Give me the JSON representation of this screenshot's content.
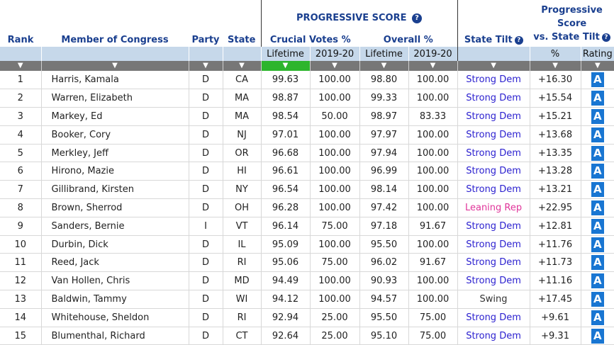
{
  "header": {
    "rank": "Rank",
    "member": "Member of Congress",
    "party": "Party",
    "state": "State",
    "progressive_score": "PROGRESSIVE SCORE",
    "crucial_votes": "Crucial Votes %",
    "overall": "Overall %",
    "state_tilt": "State Tilt",
    "vs_tilt_line1": "Progressive",
    "vs_tilt_line2": "Score",
    "vs_tilt_line3": "vs. State Tilt",
    "lifetime": "Lifetime",
    "period": "2019-20",
    "pct": "%",
    "rating": "Rating",
    "help_glyph": "?",
    "sort_arrow": "▼"
  },
  "colors": {
    "header_text": "#1a3f8f",
    "subheader_bg": "#c6d8ea",
    "sort_bar_bg": "#777777",
    "sort_active_bg": "#2db52d",
    "strong_dem": "#2a1fcf",
    "leaning_rep": "#e0359a",
    "grade_bg": "#1976d2"
  },
  "rows": [
    {
      "rank": "1",
      "name": "Harris, Kamala",
      "party": "D",
      "state": "CA",
      "cv_life": "99.63",
      "cv_1920": "100.00",
      "ov_life": "98.80",
      "ov_1920": "100.00",
      "tilt": "Strong Dem",
      "tilt_kind": "dem",
      "vs": "+16.30",
      "grade": "A"
    },
    {
      "rank": "2",
      "name": "Warren, Elizabeth",
      "party": "D",
      "state": "MA",
      "cv_life": "98.87",
      "cv_1920": "100.00",
      "ov_life": "99.33",
      "ov_1920": "100.00",
      "tilt": "Strong Dem",
      "tilt_kind": "dem",
      "vs": "+15.54",
      "grade": "A"
    },
    {
      "rank": "3",
      "name": "Markey, Ed",
      "party": "D",
      "state": "MA",
      "cv_life": "98.54",
      "cv_1920": "50.00",
      "ov_life": "98.97",
      "ov_1920": "83.33",
      "tilt": "Strong Dem",
      "tilt_kind": "dem",
      "vs": "+15.21",
      "grade": "A"
    },
    {
      "rank": "4",
      "name": "Booker, Cory",
      "party": "D",
      "state": "NJ",
      "cv_life": "97.01",
      "cv_1920": "100.00",
      "ov_life": "97.97",
      "ov_1920": "100.00",
      "tilt": "Strong Dem",
      "tilt_kind": "dem",
      "vs": "+13.68",
      "grade": "A"
    },
    {
      "rank": "5",
      "name": "Merkley, Jeff",
      "party": "D",
      "state": "OR",
      "cv_life": "96.68",
      "cv_1920": "100.00",
      "ov_life": "97.94",
      "ov_1920": "100.00",
      "tilt": "Strong Dem",
      "tilt_kind": "dem",
      "vs": "+13.35",
      "grade": "A"
    },
    {
      "rank": "6",
      "name": "Hirono, Mazie",
      "party": "D",
      "state": "HI",
      "cv_life": "96.61",
      "cv_1920": "100.00",
      "ov_life": "96.99",
      "ov_1920": "100.00",
      "tilt": "Strong Dem",
      "tilt_kind": "dem",
      "vs": "+13.28",
      "grade": "A"
    },
    {
      "rank": "7",
      "name": "Gillibrand, Kirsten",
      "party": "D",
      "state": "NY",
      "cv_life": "96.54",
      "cv_1920": "100.00",
      "ov_life": "98.14",
      "ov_1920": "100.00",
      "tilt": "Strong Dem",
      "tilt_kind": "dem",
      "vs": "+13.21",
      "grade": "A"
    },
    {
      "rank": "8",
      "name": "Brown, Sherrod",
      "party": "D",
      "state": "OH",
      "cv_life": "96.28",
      "cv_1920": "100.00",
      "ov_life": "97.42",
      "ov_1920": "100.00",
      "tilt": "Leaning Rep",
      "tilt_kind": "rep",
      "vs": "+22.95",
      "grade": "A"
    },
    {
      "rank": "9",
      "name": "Sanders, Bernie",
      "party": "I",
      "state": "VT",
      "cv_life": "96.14",
      "cv_1920": "75.00",
      "ov_life": "97.18",
      "ov_1920": "91.67",
      "tilt": "Strong Dem",
      "tilt_kind": "dem",
      "vs": "+12.81",
      "grade": "A"
    },
    {
      "rank": "10",
      "name": "Durbin, Dick",
      "party": "D",
      "state": "IL",
      "cv_life": "95.09",
      "cv_1920": "100.00",
      "ov_life": "95.50",
      "ov_1920": "100.00",
      "tilt": "Strong Dem",
      "tilt_kind": "dem",
      "vs": "+11.76",
      "grade": "A"
    },
    {
      "rank": "11",
      "name": "Reed, Jack",
      "party": "D",
      "state": "RI",
      "cv_life": "95.06",
      "cv_1920": "75.00",
      "ov_life": "96.02",
      "ov_1920": "91.67",
      "tilt": "Strong Dem",
      "tilt_kind": "dem",
      "vs": "+11.73",
      "grade": "A"
    },
    {
      "rank": "12",
      "name": "Van Hollen, Chris",
      "party": "D",
      "state": "MD",
      "cv_life": "94.49",
      "cv_1920": "100.00",
      "ov_life": "90.93",
      "ov_1920": "100.00",
      "tilt": "Strong Dem",
      "tilt_kind": "dem",
      "vs": "+11.16",
      "grade": "A"
    },
    {
      "rank": "13",
      "name": "Baldwin, Tammy",
      "party": "D",
      "state": "WI",
      "cv_life": "94.12",
      "cv_1920": "100.00",
      "ov_life": "94.57",
      "ov_1920": "100.00",
      "tilt": "Swing",
      "tilt_kind": "swing",
      "vs": "+17.45",
      "grade": "A"
    },
    {
      "rank": "14",
      "name": "Whitehouse, Sheldon",
      "party": "D",
      "state": "RI",
      "cv_life": "92.94",
      "cv_1920": "25.00",
      "ov_life": "95.50",
      "ov_1920": "75.00",
      "tilt": "Strong Dem",
      "tilt_kind": "dem",
      "vs": "+9.61",
      "grade": "A"
    },
    {
      "rank": "15",
      "name": "Blumenthal, Richard",
      "party": "D",
      "state": "CT",
      "cv_life": "92.64",
      "cv_1920": "25.00",
      "ov_life": "95.10",
      "ov_1920": "75.00",
      "tilt": "Strong Dem",
      "tilt_kind": "dem",
      "vs": "+9.31",
      "grade": "A"
    }
  ]
}
